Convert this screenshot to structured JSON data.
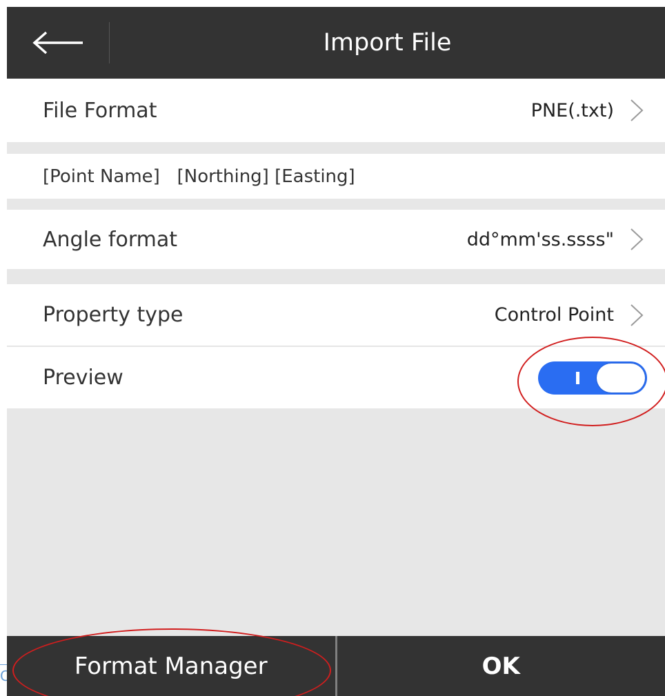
{
  "header": {
    "back_icon": "arrow-left-icon",
    "title": "Import File"
  },
  "rows": {
    "file_format": {
      "label": "File Format",
      "value": "PNE(.txt)"
    },
    "fields": {
      "label": "[Point Name]   [Northing] [Easting]"
    },
    "angle_format": {
      "label": "Angle format",
      "value": "dd°mm'ss.ssss\""
    },
    "property_type": {
      "label": "Property type",
      "value": "Control Point"
    },
    "preview": {
      "label": "Preview",
      "enabled": true
    }
  },
  "footer": {
    "format_manager_label": "Format Manager",
    "ok_label": "OK"
  },
  "colors": {
    "header_bg": "#333333",
    "toggle_on": "#2a6df2",
    "annotation": "#d11e1e",
    "background": "#e7e7e7"
  },
  "corner_text": "C"
}
